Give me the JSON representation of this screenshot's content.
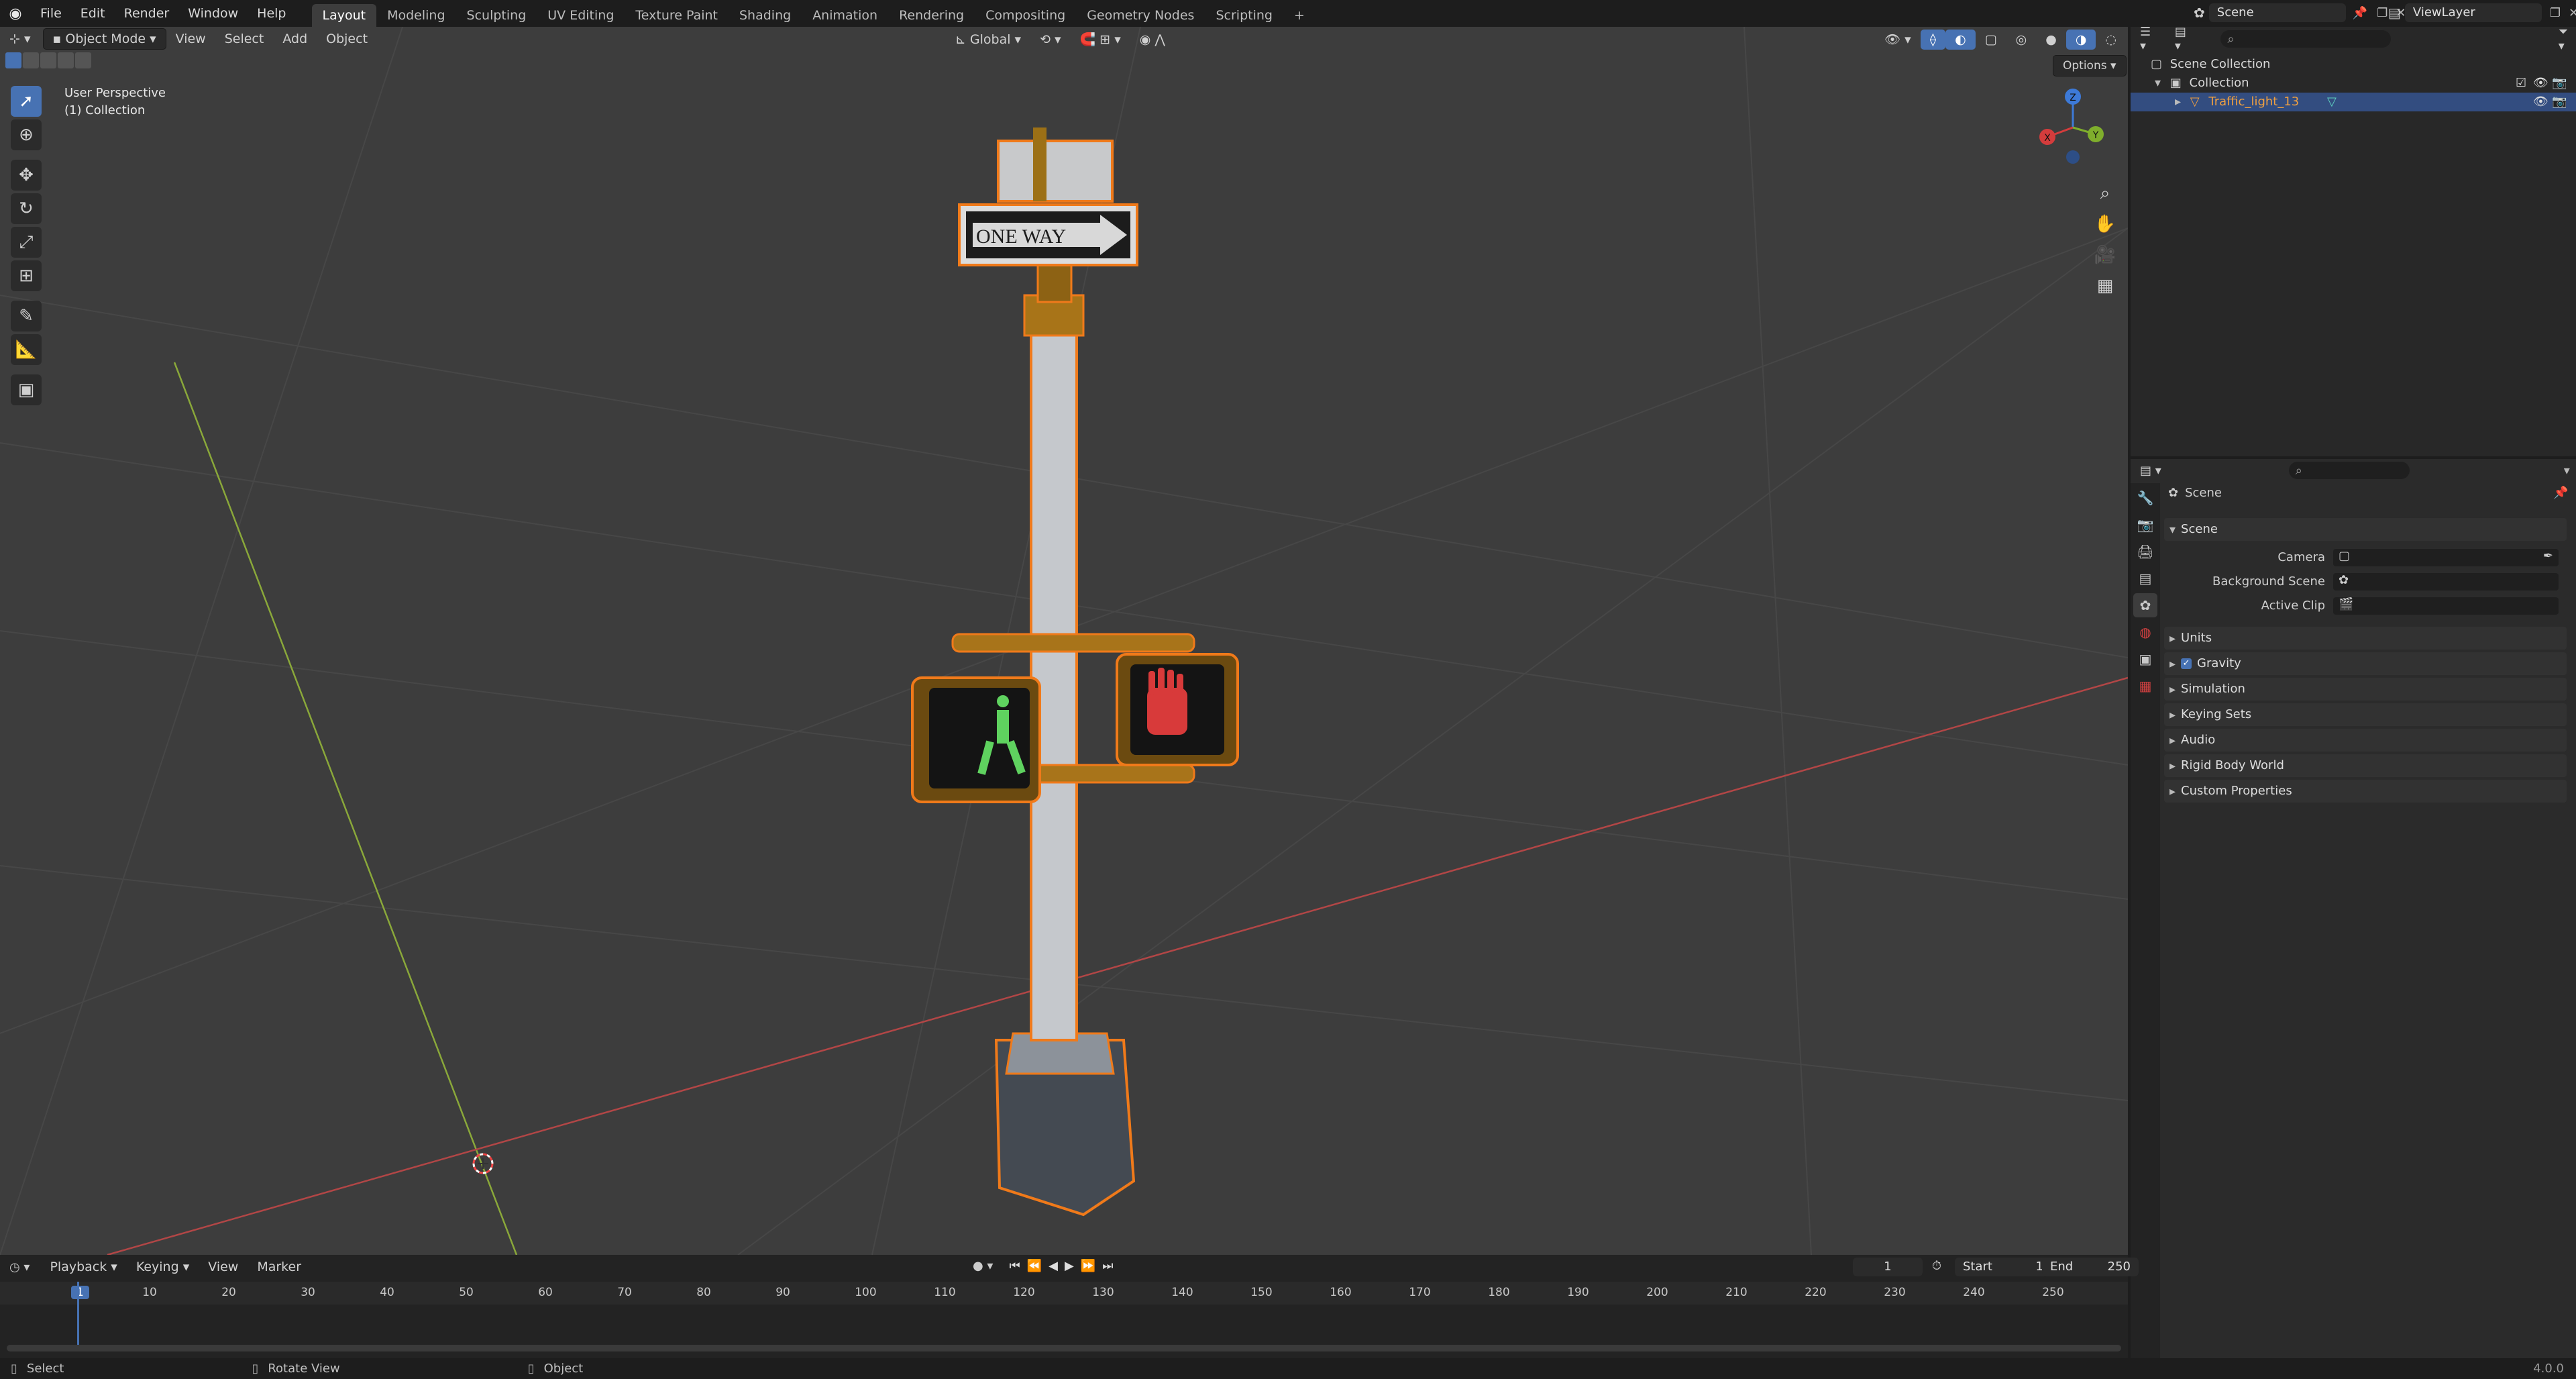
{
  "topbar": {
    "menus": [
      "File",
      "Edit",
      "Render",
      "Window",
      "Help"
    ],
    "workspaces": [
      "Layout",
      "Modeling",
      "Sculpting",
      "UV Editing",
      "Texture Paint",
      "Shading",
      "Animation",
      "Rendering",
      "Compositing",
      "Geometry Nodes",
      "Scripting"
    ],
    "active_workspace": "Layout",
    "add_tab": "+",
    "scene_name": "Scene",
    "view_layer": "ViewLayer"
  },
  "viewport": {
    "mode": "Object Mode",
    "menus": [
      "View",
      "Select",
      "Add",
      "Object"
    ],
    "transform_orientation": "Global",
    "options_label": "Options",
    "overlay_title": "User Perspective",
    "overlay_subtitle": "(1) Collection",
    "gizmo_axes": {
      "x": "X",
      "y": "Y",
      "z": "Z"
    },
    "sign_text": "ONE WAY"
  },
  "outliner": {
    "root": "Scene Collection",
    "collection": "Collection",
    "object": "Traffic_light_13"
  },
  "properties": {
    "breadcrumb": "Scene",
    "section": "Scene",
    "fields": [
      {
        "label": "Camera"
      },
      {
        "label": "Background Scene"
      },
      {
        "label": "Active Clip"
      }
    ],
    "panels": [
      "Units",
      "Gravity",
      "Simulation",
      "Keying Sets",
      "Audio",
      "Rigid Body World",
      "Custom Properties"
    ],
    "gravity_checked": true
  },
  "timeline": {
    "menus": [
      "Playback",
      "Keying",
      "View",
      "Marker"
    ],
    "current_frame": "1",
    "start_label": "Start",
    "start_value": "1",
    "end_label": "End",
    "end_value": "250",
    "ruler": [
      "1",
      "10",
      "20",
      "30",
      "40",
      "50",
      "60",
      "70",
      "80",
      "90",
      "100",
      "110",
      "120",
      "130",
      "140",
      "150",
      "160",
      "170",
      "180",
      "190",
      "200",
      "210",
      "220",
      "230",
      "240",
      "250"
    ]
  },
  "statusbar": {
    "items": [
      "Select",
      "Rotate View",
      "Object"
    ],
    "version": "4.0.0"
  },
  "colors": {
    "accent": "#4772b3",
    "selection_outline": "#f07a1a",
    "x_axis": "#d43c3c",
    "y_axis": "#7fae2c",
    "z_axis": "#3d7ad8"
  }
}
